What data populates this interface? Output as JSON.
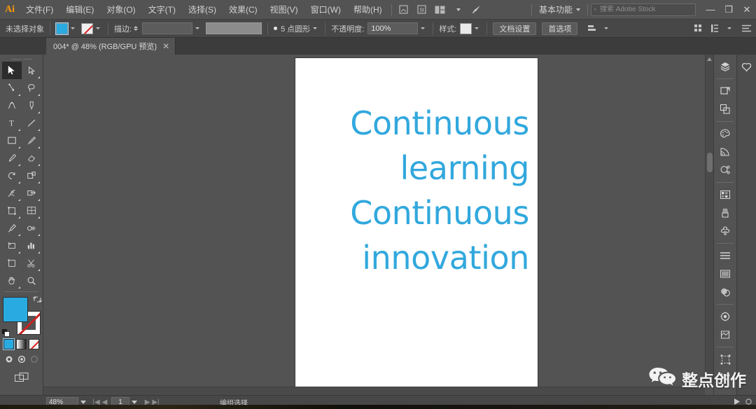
{
  "app": {
    "name": "Adobe Illustrator",
    "logo_text": "Ai"
  },
  "menubar": {
    "items": [
      {
        "label": "文件(F)",
        "name": "menu-file"
      },
      {
        "label": "编辑(E)",
        "name": "menu-edit"
      },
      {
        "label": "对象(O)",
        "name": "menu-object"
      },
      {
        "label": "文字(T)",
        "name": "menu-type"
      },
      {
        "label": "选择(S)",
        "name": "menu-select"
      },
      {
        "label": "效果(C)",
        "name": "menu-effect"
      },
      {
        "label": "视图(V)",
        "name": "menu-view"
      },
      {
        "label": "窗口(W)",
        "name": "menu-window"
      },
      {
        "label": "帮助(H)",
        "name": "menu-help"
      }
    ],
    "workspace": "基本功能",
    "search_placeholder": "搜索 Adobe Stock",
    "search_value": "",
    "minimize": "—",
    "restore": "❐",
    "close": "✕"
  },
  "controlbar": {
    "selection_label": "未选择对象",
    "fill_color": "#29abe2",
    "stroke_label": "描边:",
    "stroke_weight": "",
    "stroke_profile": "",
    "brush_label": "5 点圆形",
    "opacity_label": "不透明度:",
    "opacity_value": "100%",
    "style_label": "样式:",
    "doc_setup_button": "文档设置",
    "preferences_button": "首选项"
  },
  "tab": {
    "title": "004* @ 48% (RGB/GPU 预览)",
    "close": "✕"
  },
  "toolbar": {
    "tools_left": [
      "selection-tool",
      "direct-selection-tool",
      "curvature-tool",
      "type-tool",
      "rectangle-tool",
      "paintbrush-tool",
      "rotate-tool",
      "width-tool",
      "free-transform-tool",
      "mesh-tool",
      "eyedropper-tool",
      "slice-tool",
      "artboard-tool",
      "hand-tool"
    ],
    "tools_right": [
      "magic-wand-tool",
      "lasso-tool",
      "pen-tool",
      "line-segment-tool",
      "pencil-tool",
      "eraser-tool",
      "scale-tool",
      "shape-builder-tool",
      "perspective-grid-tool",
      "gradient-tool",
      "blend-tool",
      "graph-tool",
      "scissors-tool",
      "zoom-tool"
    ],
    "fill_color": "#29abe2",
    "stroke_mode": "none",
    "color_modes": [
      "color-mode-button",
      "gradient-mode-button",
      "none-mode-button"
    ],
    "screen_modes": [
      "draw-normal",
      "draw-behind",
      "draw-inside"
    ]
  },
  "artboard": {
    "text_color": "#31a8dd",
    "lines": [
      "Continuous",
      "learning",
      "Continuous",
      "innovation"
    ]
  },
  "dock": {
    "group_1": [
      "layers-panel-icon",
      "libraries-panel-icon"
    ],
    "group_2": [
      "artboards-panel-icon",
      "asset-export-panel-icon"
    ],
    "group_3": [
      "color-panel-icon",
      "color-guide-panel-icon",
      "color-themes-panel-icon"
    ],
    "group_4": [
      "swatches-panel-icon",
      "brushes-panel-icon",
      "symbols-panel-icon"
    ],
    "group_5": [
      "stroke-panel-icon",
      "gradient-panel-icon",
      "transparency-panel-icon"
    ],
    "group_6": [
      "appearance-panel-icon",
      "graphic-styles-panel-icon"
    ],
    "group_7": [
      "transform-panel-icon",
      "align-panel-icon"
    ]
  },
  "statusbar": {
    "zoom": "48%",
    "artboard_number": "1",
    "tool_name": "编组选择",
    "nav_first": "|◀",
    "nav_prev": "◀",
    "nav_next": "▶",
    "nav_last": "▶|"
  },
  "watermark": {
    "text": "整点创作",
    "icon": "wechat-icon"
  }
}
